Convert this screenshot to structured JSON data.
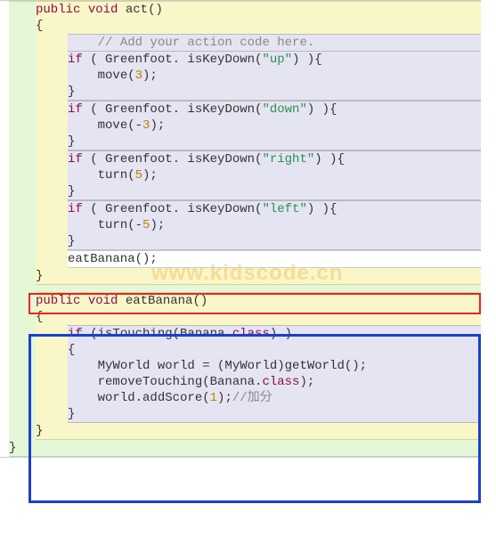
{
  "code": {
    "method_act": {
      "signature_kw_public": "public",
      "signature_kw_void": "void",
      "signature_name": "act",
      "signature_parens": "()",
      "open_brace": "{",
      "comment": "// Add your action code here.",
      "if_up_head": "if ( Greenfoot. isKeyDown(",
      "if_up_str": "\"up\"",
      "if_up_tail": ") ){",
      "if_up_body": "move(3);",
      "if_up_close": "}",
      "if_down_head": "if ( Greenfoot. isKeyDown(",
      "if_down_str": "\"down\"",
      "if_down_tail": ") ){",
      "if_down_body": "move(-3);",
      "if_down_close": "}",
      "if_right_head": "if ( Greenfoot. isKeyDown(",
      "if_right_str": "\"right\"",
      "if_right_tail": ") ){",
      "if_right_body": "turn(5);",
      "if_right_close": "}",
      "if_left_head": "if ( Greenfoot. isKeyDown(",
      "if_left_str": "\"left\"",
      "if_left_tail": ") ){",
      "if_left_body": "turn(-5);",
      "if_left_close": "}",
      "call_eat": "eatBanana();",
      "close_brace": "}"
    },
    "method_eat": {
      "signature_kw_public": "public",
      "signature_kw_void": "void",
      "signature_name": "eatBanana",
      "signature_parens": "()",
      "open_brace": "{",
      "if_head_a": "if (isTouching(Banana.",
      "if_head_kw": "class",
      "if_head_b": ") )",
      "if_open": "{",
      "body_l1": "MyWorld world = (MyWorld)getWorld();",
      "body_l2_a": "removeTouching(Banana.",
      "body_l2_kw": "class",
      "body_l2_b": ");",
      "body_l3_a": "world.addScore(1);",
      "body_l3_comment": "//加分",
      "if_close": "}",
      "close_brace": "}"
    },
    "class_close": "}"
  },
  "watermark": "www.kidscode.cn"
}
